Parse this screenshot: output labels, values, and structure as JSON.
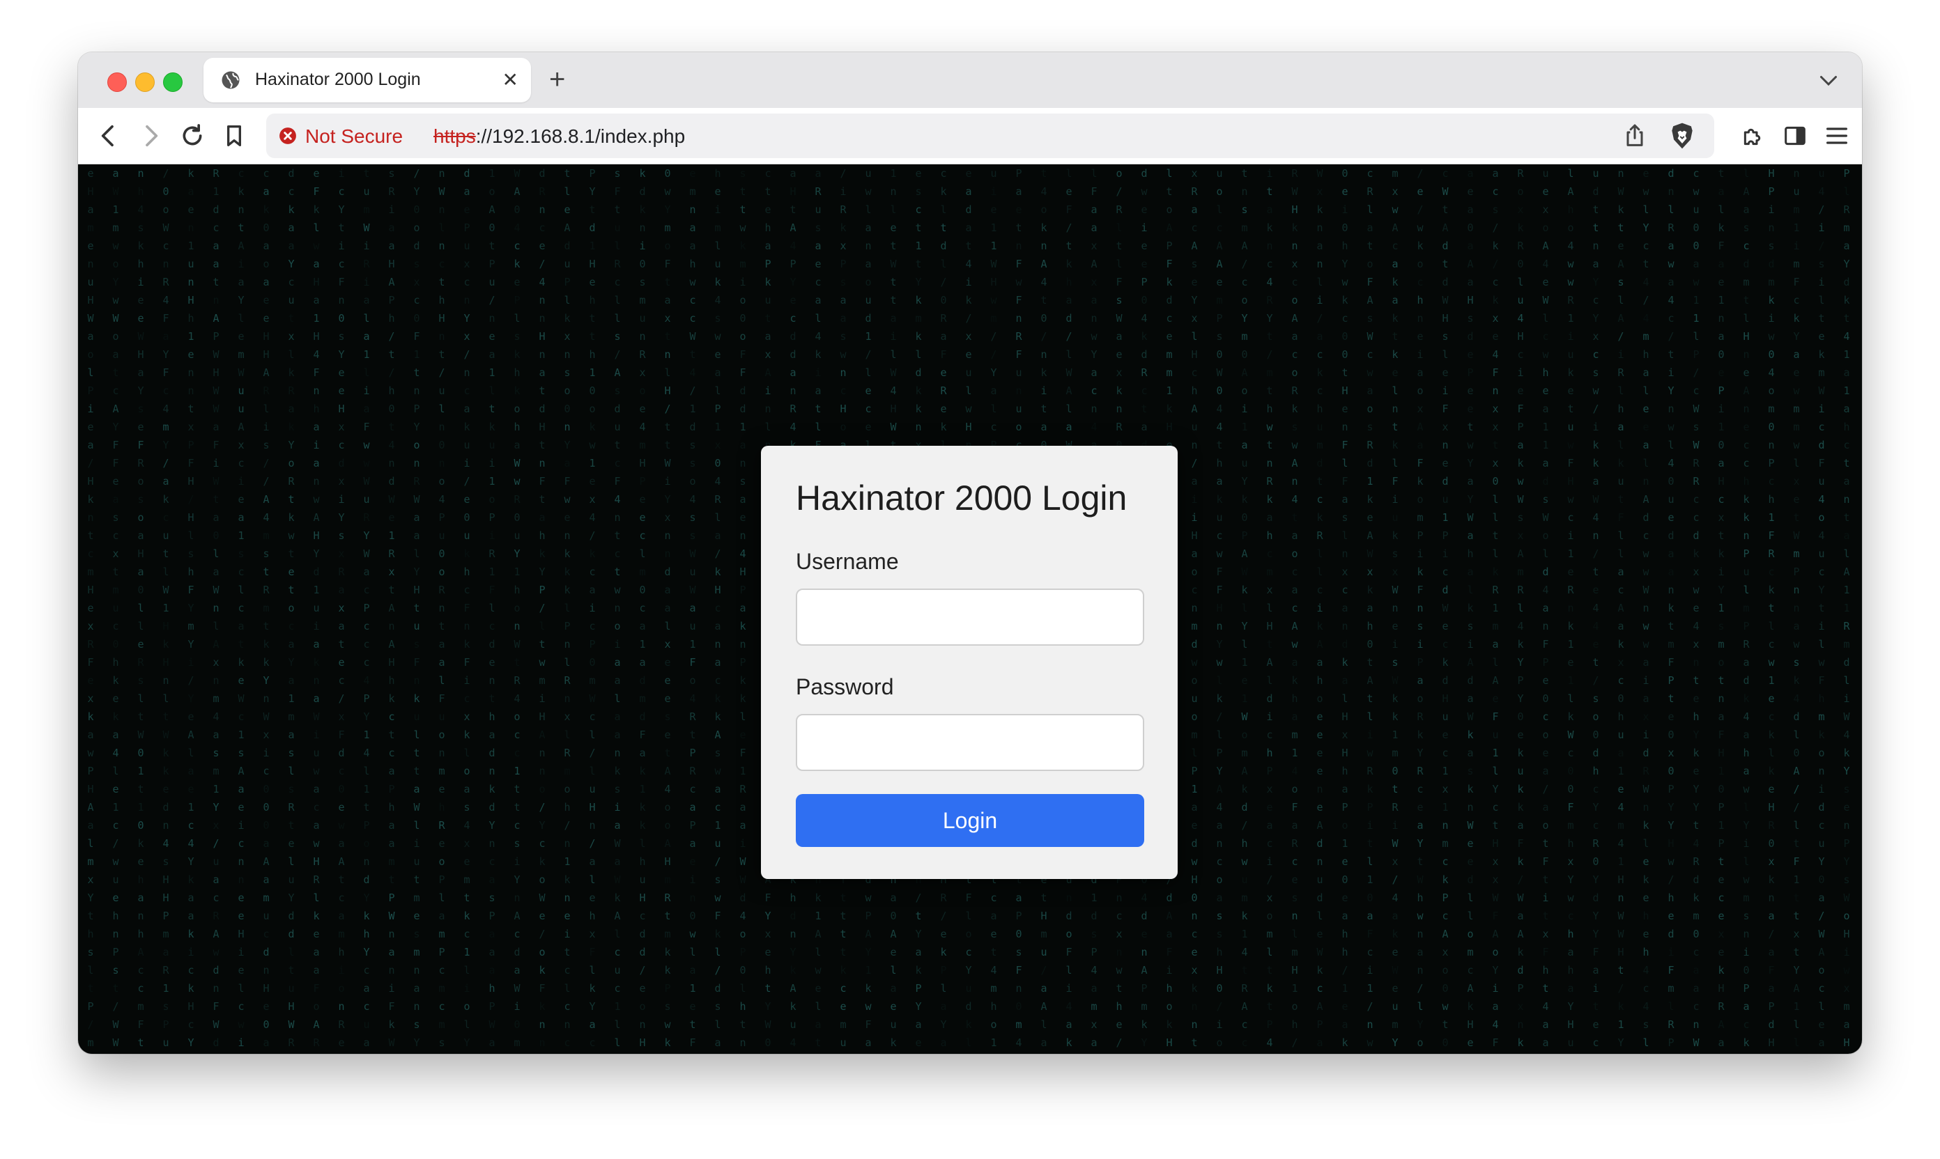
{
  "browser": {
    "tab": {
      "title": "Haxinator 2000 Login",
      "icon": "globe-icon",
      "close_glyph": "✕"
    },
    "new_tab_glyph": "+",
    "address": {
      "security_label": "Not Secure",
      "url_scheme": "https",
      "url_rest": "://192.168.8.1/index.php"
    },
    "icons": [
      "back-icon",
      "forward-icon",
      "reload-icon",
      "bookmark-icon",
      "share-icon",
      "brave-shield-icon",
      "extensions-icon",
      "sidebar-icon",
      "menu-icon",
      "tab-list-chevron-icon"
    ]
  },
  "login": {
    "title": "Haxinator 2000 Login",
    "username_label": "Username",
    "username_value": "",
    "password_label": "Password",
    "password_value": "",
    "button_label": "Login"
  },
  "background": {
    "style": "matrix-rain",
    "glyph_color": "#3fb6b1",
    "base_color": "#050807"
  },
  "colors": {
    "accent": "#2f6ff2",
    "warning": "#c5221f"
  }
}
